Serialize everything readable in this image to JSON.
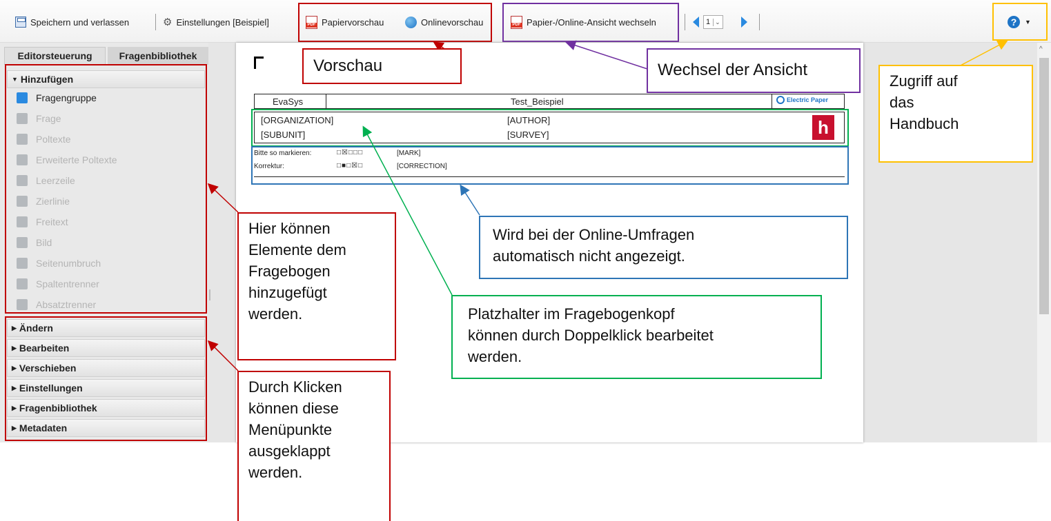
{
  "toolbar": {
    "save_label": "Speichern und verlassen",
    "settings_label": "Einstellungen [Beispiel]",
    "paper_preview_label": "Papiervorschau",
    "online_preview_label": "Onlinevorschau",
    "switch_view_label": "Papier-/Online-Ansicht wechseln",
    "page_value": "1",
    "help_icon": "?"
  },
  "tabs": {
    "editor": "Editorsteuerung",
    "library": "Fragenbibliothek"
  },
  "sidebar": {
    "add_header": "Hinzufügen",
    "items": [
      {
        "label": "Fragengruppe",
        "icon": "group-icon"
      },
      {
        "label": "Frage",
        "icon": "question-icon"
      },
      {
        "label": "Poltexte",
        "icon": "poltext-icon"
      },
      {
        "label": "Erweiterte Poltexte",
        "icon": "extended-poltext-icon"
      },
      {
        "label": "Leerzeile",
        "icon": "blank-line-icon"
      },
      {
        "label": "Zierlinie",
        "icon": "line-icon"
      },
      {
        "label": "Freitext",
        "icon": "freetext-icon"
      },
      {
        "label": "Bild",
        "icon": "image-icon"
      },
      {
        "label": "Seitenumbruch",
        "icon": "pagebreak-icon"
      },
      {
        "label": "Spaltentrenner",
        "icon": "column-separator-icon"
      },
      {
        "label": "Absatztrenner",
        "icon": "paragraph-separator-icon"
      }
    ],
    "sections": [
      "Ändern",
      "Bearbeiten",
      "Verschieben",
      "Einstellungen",
      "Fragenbibliothek",
      "Metadaten"
    ]
  },
  "form": {
    "org": "EvaSys",
    "title": "Test_Beispiel",
    "brand": "Electric Paper",
    "organization": "[ORGANIZATION]",
    "subunit": "[SUBUNIT]",
    "author": "[AUTHOR]",
    "survey": "[SURVEY]",
    "mark_label": "Bitte so markieren:",
    "mark_value": "[MARK]",
    "correction_label": "Korrektur:",
    "correction_value": "[CORRECTION]"
  },
  "annotations": {
    "preview": "Vorschau",
    "switch": "Wechsel der Ansicht",
    "manual": [
      "Zugriff auf",
      "das",
      "Handbuch"
    ],
    "add": [
      "Hier können",
      "Elemente dem",
      "Fragebogen",
      "hinzugefügt",
      "werden."
    ],
    "expand": [
      "Durch Klicken",
      "können diese",
      "Menüpunkte",
      "ausgeklappt",
      "werden."
    ],
    "online": [
      "Wird bei der Online-Umfragen",
      "automatisch nicht angezeigt."
    ],
    "placeholder": [
      "Platzhalter im Fragebogenkopf",
      "können durch Doppelklick bearbeitet",
      "werden."
    ]
  },
  "colors": {
    "red": "#c00000",
    "purple": "#7030a0",
    "gold": "#ffc000",
    "blue": "#2e75b6",
    "green": "#00b050"
  }
}
